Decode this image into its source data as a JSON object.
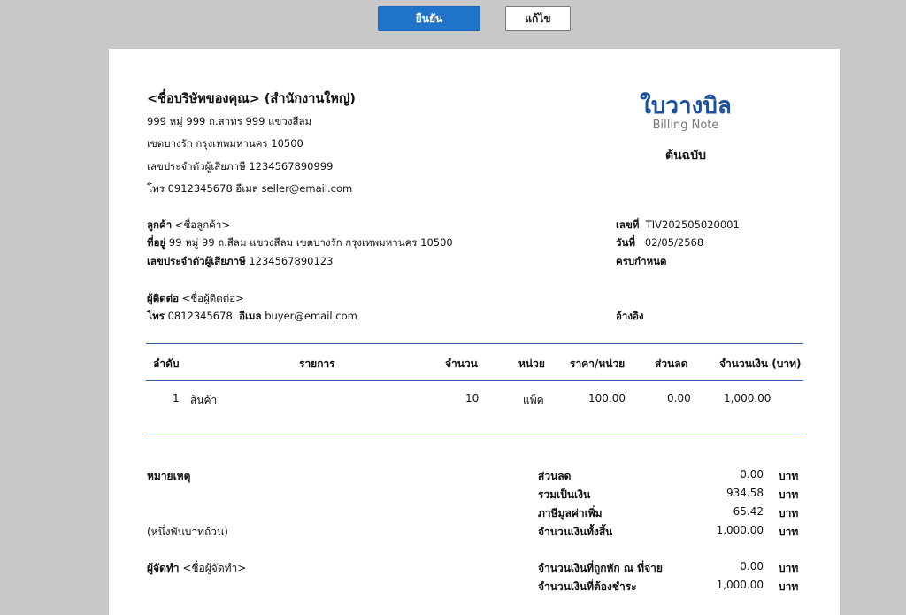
{
  "toolbar": {
    "confirm_label": "ยืนยัน",
    "edit_label": "แก้ไข"
  },
  "seller": {
    "name": "<ชื่อบริษัทของคุณ> (สำนักงานใหญ่)",
    "address1": "999 หมู่ 999 ถ.สาทร 999 แขวงสีลม",
    "address2": "เขตบางรัก  กรุงเทพมหานคร 10500",
    "tax_id": "เลขประจำตัวผู้เสียภาษี 1234567890999",
    "contact": "โทร 0912345678  อีเมล seller@email.com"
  },
  "document": {
    "title": "ใบวางบิล",
    "subtitle": "Billing Note",
    "copy": "ต้นฉบับ"
  },
  "customer": {
    "customer_label": "ลูกค้า",
    "customer_value": "<ชื่อลูกค้า>",
    "address_label": "ที่อยู่",
    "address_value": "99 หมู่ 99 ถ.สีลม แขวงสีลม เขตบางรัก กรุงเทพมหานคร 10500",
    "tax_label": "เลขประจำตัวผู้เสียภาษี",
    "tax_value": "1234567890123",
    "contact_label": "ผู้ติดต่อ",
    "contact_value": "<ชื่อผู้ติดต่อ>",
    "phone_label": "โทร",
    "phone_value": "0812345678",
    "email_label": "อีเมล",
    "email_value": "buyer@email.com"
  },
  "meta": {
    "number_label": "เลขที่",
    "number_value": "TIV202505020001",
    "date_label": "วันที่",
    "date_value": "02/05/2568",
    "due_label": "ครบกำหนด",
    "ref_label": "อ้างอิง"
  },
  "table": {
    "headers": [
      "ลำดับ",
      "รายการ",
      "จำนวน",
      "หน่วย",
      "ราคา/หน่วย",
      "ส่วนลด",
      "จำนวนเงิน (บาท)"
    ],
    "rows": [
      {
        "no": "1",
        "item": "สินค้า",
        "qty": "10",
        "unit": "แพ็ค",
        "price": "100.00",
        "discount": "0.00",
        "amount": "1,000.00"
      }
    ]
  },
  "remarks": {
    "label": "หมายเหตุ",
    "amount_text": "(หนึ่งพันบาทถ้วน)"
  },
  "preparer": {
    "label": "ผู้จัดทำ",
    "value": "<ชื่อผู้จัดทำ>"
  },
  "summary": {
    "currency": "บาท",
    "lines": [
      {
        "label": "ส่วนลด",
        "value": "0.00"
      },
      {
        "label": "รวมเป็นเงิน",
        "value": "934.58"
      },
      {
        "label": "ภาษีมูลค่าเพิ่ม",
        "value": "65.42"
      },
      {
        "label": "จำนวนเงินทั้งสิ้น",
        "value": "1,000.00"
      },
      {
        "label": "จำนวนเงินที่ถูกหัก ณ ที่จ่าย",
        "value": "0.00"
      },
      {
        "label": "จำนวนเงินที่ต้องชำระ",
        "value": "1,000.00"
      }
    ]
  },
  "colors": {
    "background": "#c8c8c8",
    "primary_button": "#1f74c9",
    "title": "#1e4f9b",
    "rule": "#2a5db0"
  }
}
